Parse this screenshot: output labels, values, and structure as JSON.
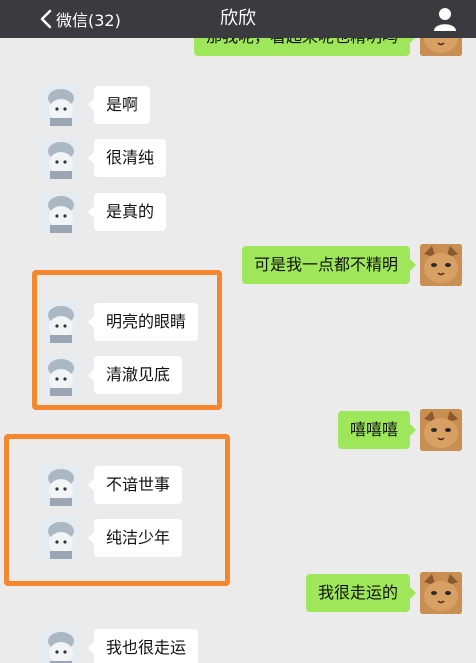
{
  "nav": {
    "back_label": "微信(32)",
    "title": "欣欣",
    "back_icon": "chevron-left-icon",
    "profile_icon": "person-icon"
  },
  "colors": {
    "navbar": "#3a3a3f",
    "background": "#ebebeb",
    "bubble_self": "#9ee65a",
    "bubble_other": "#ffffff",
    "highlight": "#f5872e"
  },
  "messages": [
    {
      "side": "right",
      "text": "那我呢，看起来呢也精明吗"
    },
    {
      "side": "left",
      "text": "是啊"
    },
    {
      "side": "left",
      "text": "很清纯"
    },
    {
      "side": "left",
      "text": "是真的"
    },
    {
      "side": "right",
      "text": "可是我一点都不精明"
    },
    {
      "side": "left",
      "text": "明亮的眼睛"
    },
    {
      "side": "left",
      "text": "清澈见底"
    },
    {
      "side": "right",
      "text": "嘻嘻嘻"
    },
    {
      "side": "left",
      "text": "不谙世事"
    },
    {
      "side": "left",
      "text": "纯洁少年"
    },
    {
      "side": "right",
      "text": "我很走运的"
    },
    {
      "side": "left",
      "text": "我也很走运"
    }
  ]
}
